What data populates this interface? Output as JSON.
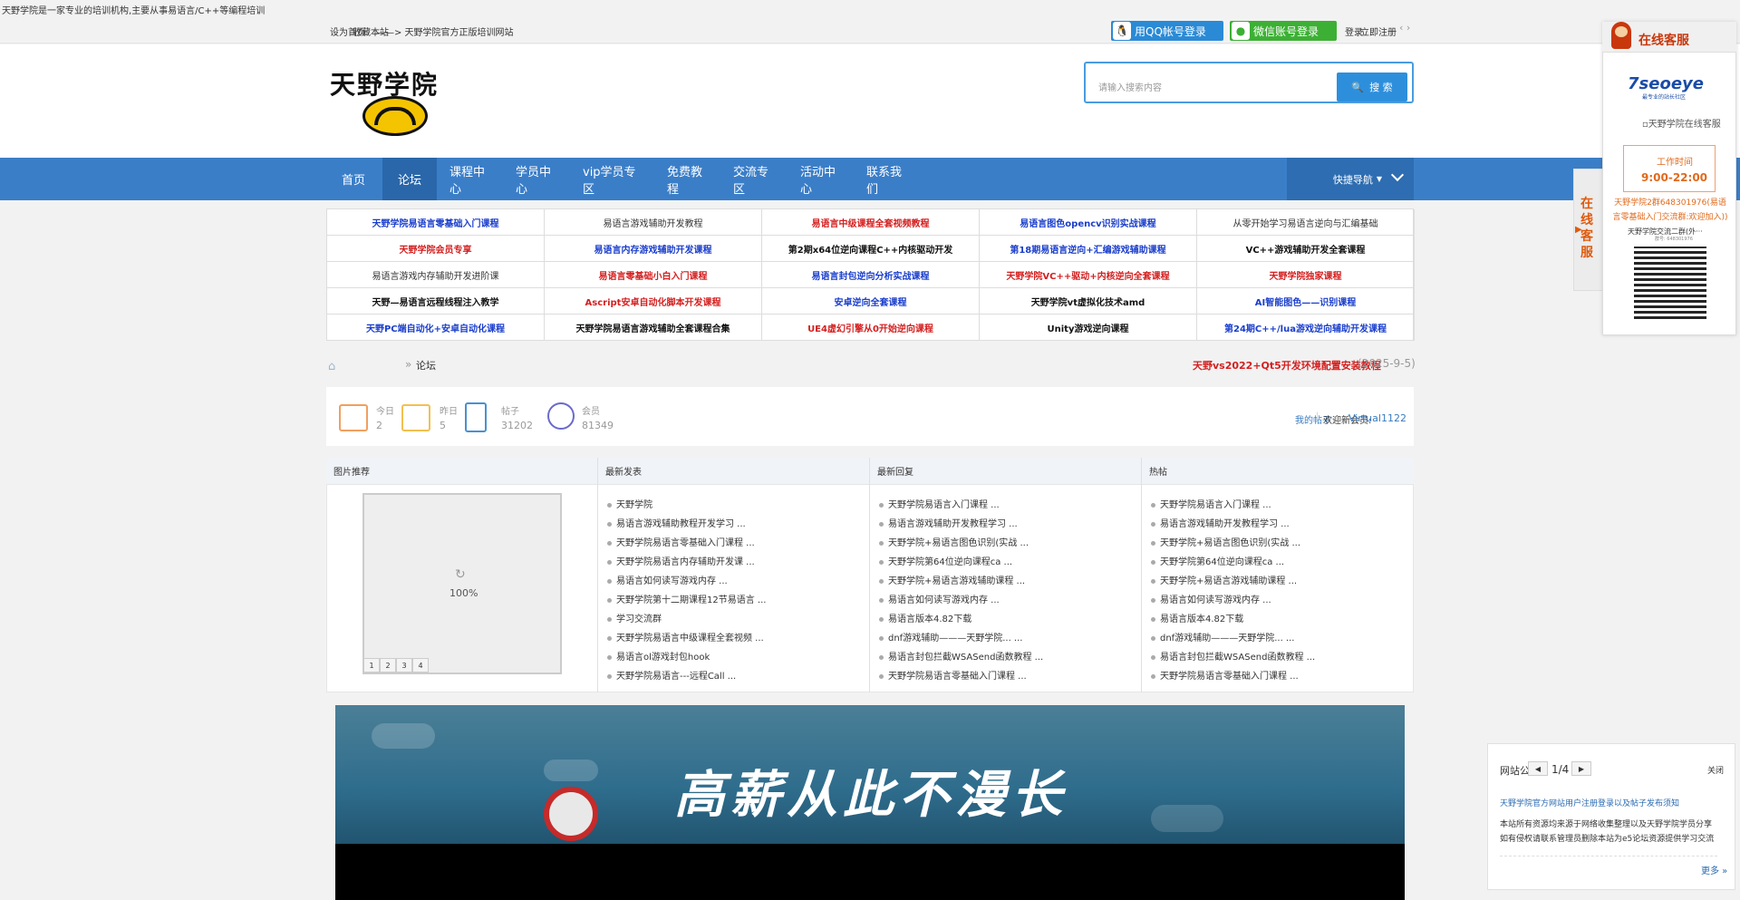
{
  "topbar": {
    "notice": "天野学院是一家专业的培训机构,主要从事易语言/C++等编程培训",
    "links": [
      "设为首页",
      "收藏本站",
      "——> 天野学院官方正版培训网站"
    ],
    "qq_login": "用QQ帐号登录",
    "wechat_login": "微信账号登录",
    "login": "登录",
    "register": "立即注册"
  },
  "header": {
    "logo_text": "天野学院",
    "search_placeholder": "请输入搜索内容",
    "search_button": "搜 索"
  },
  "nav": {
    "items": [
      "首页",
      "论坛",
      "课程中心",
      "学员中心",
      "vip学员专区",
      "免费教程",
      "交流专区",
      "活动中心",
      "联系我们"
    ],
    "right_label": "快捷导航"
  },
  "links": [
    [
      "天野学院易语言零基础入门课程",
      "易语言游戏辅助开发教程",
      "易语言中级课程全套视频教程",
      "易语言图色opencv识别实战课程",
      "从零开始学习易语言逆向与汇编基础"
    ],
    [
      "天野学院会员专享",
      "易语言内存游戏辅助开发课程",
      "第2期x64位逆向课程C++内核驱动开发",
      "第18期易语言逆向+汇编游戏辅助课程",
      "VC++游戏辅助开发全套课程"
    ],
    [
      "易语言游戏内存辅助开发进阶课",
      "易语言零基础小白入门课程",
      "易语言封包逆向分析实战课程",
      "天野学院VC++驱动+内核逆向全套课程",
      "天野学院独家课程"
    ],
    [
      "天野—易语言远程线程注入教学",
      "Ascript安卓自动化脚本开发课程",
      "安卓逆向全套课程",
      "天野学院vt虚拟化技术amd",
      "AI智能图色——识别课程"
    ],
    [
      "天野PC端自动化+安卓自动化课程",
      "天野学院易语言游戏辅助全套课程合集",
      "UE4虚幻引擎从0开始逆向课程",
      "Unity游戏逆向课程",
      "第24期C++/lua游戏逆向辅助开发课程"
    ]
  ],
  "link_colors": [
    [
      "#1a3ecc",
      "#333333",
      "#d42020",
      "#1a3ecc",
      "#333333"
    ],
    [
      "#d42020",
      "#1a3ecc",
      "#111111",
      "#1a3ecc",
      "#111111"
    ],
    [
      "#333333",
      "#d42020",
      "#1a3ecc",
      "#d42020",
      "#d42020"
    ],
    [
      "#111111",
      "#d42020",
      "#1a3ecc",
      "#111111",
      "#1a3ecc"
    ],
    [
      "#1a3ecc",
      "#111111",
      "#d42020",
      "#111111",
      "#1a3ecc"
    ]
  ],
  "breadcrumb": {
    "home": "⌂",
    "separator": "»",
    "current": "论坛"
  },
  "news": {
    "title": "天野vs2022+Qt5开发环境配置安装教程",
    "date": "(2025-9-5)"
  },
  "stats": [
    {
      "label": "今日",
      "value": "2"
    },
    {
      "label": "昨日",
      "value": "5"
    },
    {
      "label": "帖子",
      "value": "31202"
    },
    {
      "label": "会员",
      "value": "81349"
    }
  ],
  "stats_right": {
    "link": "我的帖子",
    "new_member_label": "欢迎新会员:",
    "new_member": "Virtual1122"
  },
  "panels": {
    "headers": [
      "图片推荐",
      "最新发表",
      "最新回复",
      "热帖"
    ],
    "slider_percent": "100%",
    "slider_pages": [
      "1",
      "2",
      "3",
      "4"
    ],
    "latest_posts": [
      "天野学院",
      "易语言游戏辅助教程开发学习 ...",
      "天野学院易语言零基础入门课程 ...",
      "天野学院易语言内存辅助开发课 ...",
      "易语言如何读写游戏内存 ...",
      "天野学院第十二期课程12节易语言 ...",
      "学习交流群",
      "天野学院易语言中级课程全套视频 ...",
      "易语言ol游戏封包hook",
      "天野学院易语言---远程Call ..."
    ],
    "latest_replies": [
      "天野学院易语言入门课程 ...",
      "易语言游戏辅助开发教程学习 ...",
      "天野学院+易语言图色识别(实战 ...",
      "天野学院第64位逆向课程ca ...",
      "天野学院+易语言游戏辅助课程 ...",
      "易语言如何读写游戏内存 ...",
      "易语言版本4.82下载",
      "dnf游戏辅助———天野学院... ...",
      "易语言封包拦截WSASend函数教程 ...",
      "天野学院易语言零基础入门课程 ..."
    ],
    "hot_posts": [
      "天野学院易语言入门课程 ...",
      "易语言游戏辅助开发教程学习 ...",
      "天野学院+易语言图色识别(实战 ...",
      "天野学院第64位逆向课程ca ...",
      "天野学院+易语言游戏辅助课程 ...",
      "易语言如何读写游戏内存 ...",
      "易语言版本4.82下载",
      "dnf游戏辅助———天野学院... ...",
      "易语言封包拦截WSASend函数教程 ...",
      "天野学院易语言零基础入门课程 ..."
    ]
  },
  "banner": {
    "text": "高薪从此不漫长"
  },
  "customer_service": {
    "title": "在线客服",
    "logo_text": "7seoeye",
    "logo_sub": "最专业的站长社区",
    "image_alt": "天野学院在线客服",
    "worktime_label": "工作时间",
    "worktime": "9:00-22:00",
    "qq_group": "天野学院2群648301976(易语言零基础入门交流群:欢迎加入))",
    "qr_label": "天野学院交流二群(外···",
    "qr_sub": "群号: 648301976",
    "side_tab": "在线客服"
  },
  "notice_box": {
    "title": "网站公告",
    "page": "1/4",
    "close": "关闭",
    "headline": "天野学院官方网站用户注册登录以及帖子发布须知",
    "body": "本站所有资源均来源于网络收集整理以及天野学院学员分享如有侵权请联系管理员删除本站为e5论坛资源提供学习交流平台请勿用于商业用途否则后果自负。",
    "more": "更多 »"
  },
  "colors": {
    "nav_bg": "#3b7ec8",
    "nav_active": "#2a67aa",
    "accent_red": "#d42020",
    "accent_blue": "#1a3ecc",
    "qq_green": "#2a8ad6",
    "wechat_green": "#3cb034"
  }
}
